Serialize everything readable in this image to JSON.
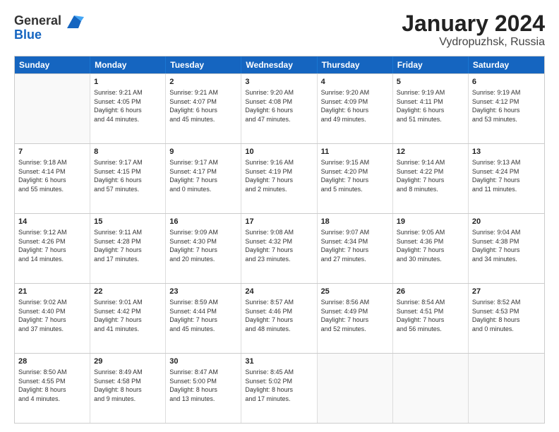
{
  "header": {
    "logo_general": "General",
    "logo_blue": "Blue",
    "title": "January 2024",
    "location": "Vydropuzhsk, Russia"
  },
  "days_of_week": [
    "Sunday",
    "Monday",
    "Tuesday",
    "Wednesday",
    "Thursday",
    "Friday",
    "Saturday"
  ],
  "weeks": [
    [
      {
        "day": "",
        "info": ""
      },
      {
        "day": "1",
        "info": "Sunrise: 9:21 AM\nSunset: 4:05 PM\nDaylight: 6 hours\nand 44 minutes."
      },
      {
        "day": "2",
        "info": "Sunrise: 9:21 AM\nSunset: 4:07 PM\nDaylight: 6 hours\nand 45 minutes."
      },
      {
        "day": "3",
        "info": "Sunrise: 9:20 AM\nSunset: 4:08 PM\nDaylight: 6 hours\nand 47 minutes."
      },
      {
        "day": "4",
        "info": "Sunrise: 9:20 AM\nSunset: 4:09 PM\nDaylight: 6 hours\nand 49 minutes."
      },
      {
        "day": "5",
        "info": "Sunrise: 9:19 AM\nSunset: 4:11 PM\nDaylight: 6 hours\nand 51 minutes."
      },
      {
        "day": "6",
        "info": "Sunrise: 9:19 AM\nSunset: 4:12 PM\nDaylight: 6 hours\nand 53 minutes."
      }
    ],
    [
      {
        "day": "7",
        "info": "Sunrise: 9:18 AM\nSunset: 4:14 PM\nDaylight: 6 hours\nand 55 minutes."
      },
      {
        "day": "8",
        "info": "Sunrise: 9:17 AM\nSunset: 4:15 PM\nDaylight: 6 hours\nand 57 minutes."
      },
      {
        "day": "9",
        "info": "Sunrise: 9:17 AM\nSunset: 4:17 PM\nDaylight: 7 hours\nand 0 minutes."
      },
      {
        "day": "10",
        "info": "Sunrise: 9:16 AM\nSunset: 4:19 PM\nDaylight: 7 hours\nand 2 minutes."
      },
      {
        "day": "11",
        "info": "Sunrise: 9:15 AM\nSunset: 4:20 PM\nDaylight: 7 hours\nand 5 minutes."
      },
      {
        "day": "12",
        "info": "Sunrise: 9:14 AM\nSunset: 4:22 PM\nDaylight: 7 hours\nand 8 minutes."
      },
      {
        "day": "13",
        "info": "Sunrise: 9:13 AM\nSunset: 4:24 PM\nDaylight: 7 hours\nand 11 minutes."
      }
    ],
    [
      {
        "day": "14",
        "info": "Sunrise: 9:12 AM\nSunset: 4:26 PM\nDaylight: 7 hours\nand 14 minutes."
      },
      {
        "day": "15",
        "info": "Sunrise: 9:11 AM\nSunset: 4:28 PM\nDaylight: 7 hours\nand 17 minutes."
      },
      {
        "day": "16",
        "info": "Sunrise: 9:09 AM\nSunset: 4:30 PM\nDaylight: 7 hours\nand 20 minutes."
      },
      {
        "day": "17",
        "info": "Sunrise: 9:08 AM\nSunset: 4:32 PM\nDaylight: 7 hours\nand 23 minutes."
      },
      {
        "day": "18",
        "info": "Sunrise: 9:07 AM\nSunset: 4:34 PM\nDaylight: 7 hours\nand 27 minutes."
      },
      {
        "day": "19",
        "info": "Sunrise: 9:05 AM\nSunset: 4:36 PM\nDaylight: 7 hours\nand 30 minutes."
      },
      {
        "day": "20",
        "info": "Sunrise: 9:04 AM\nSunset: 4:38 PM\nDaylight: 7 hours\nand 34 minutes."
      }
    ],
    [
      {
        "day": "21",
        "info": "Sunrise: 9:02 AM\nSunset: 4:40 PM\nDaylight: 7 hours\nand 37 minutes."
      },
      {
        "day": "22",
        "info": "Sunrise: 9:01 AM\nSunset: 4:42 PM\nDaylight: 7 hours\nand 41 minutes."
      },
      {
        "day": "23",
        "info": "Sunrise: 8:59 AM\nSunset: 4:44 PM\nDaylight: 7 hours\nand 45 minutes."
      },
      {
        "day": "24",
        "info": "Sunrise: 8:57 AM\nSunset: 4:46 PM\nDaylight: 7 hours\nand 48 minutes."
      },
      {
        "day": "25",
        "info": "Sunrise: 8:56 AM\nSunset: 4:49 PM\nDaylight: 7 hours\nand 52 minutes."
      },
      {
        "day": "26",
        "info": "Sunrise: 8:54 AM\nSunset: 4:51 PM\nDaylight: 7 hours\nand 56 minutes."
      },
      {
        "day": "27",
        "info": "Sunrise: 8:52 AM\nSunset: 4:53 PM\nDaylight: 8 hours\nand 0 minutes."
      }
    ],
    [
      {
        "day": "28",
        "info": "Sunrise: 8:50 AM\nSunset: 4:55 PM\nDaylight: 8 hours\nand 4 minutes."
      },
      {
        "day": "29",
        "info": "Sunrise: 8:49 AM\nSunset: 4:58 PM\nDaylight: 8 hours\nand 9 minutes."
      },
      {
        "day": "30",
        "info": "Sunrise: 8:47 AM\nSunset: 5:00 PM\nDaylight: 8 hours\nand 13 minutes."
      },
      {
        "day": "31",
        "info": "Sunrise: 8:45 AM\nSunset: 5:02 PM\nDaylight: 8 hours\nand 17 minutes."
      },
      {
        "day": "",
        "info": ""
      },
      {
        "day": "",
        "info": ""
      },
      {
        "day": "",
        "info": ""
      }
    ]
  ]
}
